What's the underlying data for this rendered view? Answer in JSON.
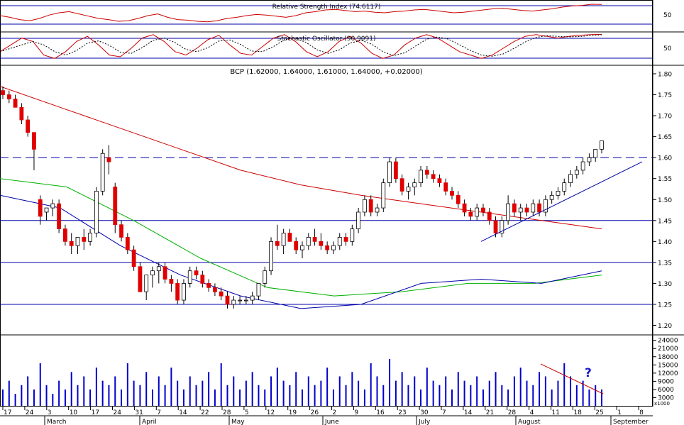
{
  "panels": {
    "rsi": {
      "title": "Relative Strength Index (74.6117)",
      "level_label": "50"
    },
    "stoch": {
      "title": "Stochastic Oscillator (90.9091)",
      "level_label": "50"
    },
    "price": {
      "title": "BCP (1.62000, 1.64000, 1.61000, 1.64000, +0.02000)"
    },
    "volume": {
      "annotation": "?"
    }
  },
  "colors": {
    "up_candle": "#ffffff",
    "down_candle": "#e00000",
    "moving_average_long": "#cc0000",
    "moving_average_short": "#00b000",
    "moving_average_mid": "#0000aa",
    "volume_bar": "#0000cc",
    "horizontal_level": "#0000aa",
    "trendline": "#0000aa",
    "volume_trendline": "#cc0000"
  },
  "chart_data": {
    "type": "candlestick",
    "title": "BCP (1.62000, 1.64000, 1.61000, 1.64000, +0.02000)",
    "price_axis": {
      "ylim": [
        1.17,
        1.82
      ],
      "ticks": [
        "1.80",
        "1.75",
        "1.70",
        "1.65",
        "1.60",
        "1.55",
        "1.50",
        "1.45",
        "1.40",
        "1.35",
        "1.30",
        "1.25",
        "1.20"
      ]
    },
    "horizontal_levels": [
      1.6,
      1.45,
      1.35,
      1.25
    ],
    "dashed_level": 1.6,
    "date_axis": {
      "day_ticks": [
        "17",
        "24",
        "3",
        "10",
        "17",
        "24",
        "31",
        "7",
        "14",
        "22",
        "28",
        "5",
        "12",
        "19",
        "26",
        "2",
        "9",
        "16",
        "23",
        "30",
        "7",
        "14",
        "21",
        "28",
        "4",
        "11",
        "18",
        "25",
        "1",
        "8"
      ],
      "month_labels": [
        "March",
        "April",
        "May",
        "June",
        "July",
        "August",
        "September"
      ]
    },
    "candles_ohlc": [
      [
        1.76,
        1.77,
        1.74,
        1.75
      ],
      [
        1.75,
        1.76,
        1.73,
        1.74
      ],
      [
        1.74,
        1.75,
        1.72,
        1.72
      ],
      [
        1.72,
        1.73,
        1.68,
        1.69
      ],
      [
        1.69,
        1.7,
        1.65,
        1.66
      ],
      [
        1.66,
        1.66,
        1.57,
        1.62
      ],
      [
        1.5,
        1.51,
        1.44,
        1.46
      ],
      [
        1.47,
        1.48,
        1.45,
        1.48
      ],
      [
        1.48,
        1.5,
        1.46,
        1.49
      ],
      [
        1.49,
        1.5,
        1.42,
        1.43
      ],
      [
        1.43,
        1.44,
        1.39,
        1.4
      ],
      [
        1.4,
        1.42,
        1.37,
        1.39
      ],
      [
        1.39,
        1.41,
        1.37,
        1.41
      ],
      [
        1.41,
        1.43,
        1.38,
        1.4
      ],
      [
        1.4,
        1.43,
        1.39,
        1.42
      ],
      [
        1.42,
        1.53,
        1.41,
        1.52
      ],
      [
        1.52,
        1.62,
        1.51,
        1.61
      ],
      [
        1.6,
        1.63,
        1.56,
        1.59
      ],
      [
        1.53,
        1.54,
        1.42,
        1.44
      ],
      [
        1.44,
        1.45,
        1.4,
        1.41
      ],
      [
        1.41,
        1.42,
        1.37,
        1.38
      ],
      [
        1.38,
        1.39,
        1.33,
        1.34
      ],
      [
        1.34,
        1.35,
        1.28,
        1.28
      ],
      [
        1.28,
        1.3,
        1.26,
        1.32
      ],
      [
        1.32,
        1.34,
        1.29,
        1.33
      ],
      [
        1.33,
        1.35,
        1.3,
        1.34
      ],
      [
        1.34,
        1.35,
        1.3,
        1.31
      ],
      [
        1.31,
        1.32,
        1.28,
        1.3
      ],
      [
        1.3,
        1.31,
        1.25,
        1.26
      ],
      [
        1.26,
        1.31,
        1.25,
        1.3
      ],
      [
        1.3,
        1.34,
        1.29,
        1.33
      ],
      [
        1.33,
        1.34,
        1.31,
        1.32
      ],
      [
        1.32,
        1.33,
        1.29,
        1.3
      ],
      [
        1.3,
        1.31,
        1.28,
        1.29
      ],
      [
        1.29,
        1.3,
        1.27,
        1.28
      ],
      [
        1.28,
        1.29,
        1.26,
        1.27
      ],
      [
        1.27,
        1.28,
        1.24,
        1.25
      ],
      [
        1.25,
        1.27,
        1.24,
        1.26
      ],
      [
        1.26,
        1.27,
        1.25,
        1.26
      ],
      [
        1.26,
        1.27,
        1.25,
        1.26
      ],
      [
        1.26,
        1.28,
        1.25,
        1.27
      ],
      [
        1.27,
        1.3,
        1.26,
        1.3
      ],
      [
        1.3,
        1.34,
        1.29,
        1.33
      ],
      [
        1.33,
        1.41,
        1.32,
        1.4
      ],
      [
        1.4,
        1.44,
        1.38,
        1.39
      ],
      [
        1.39,
        1.43,
        1.37,
        1.42
      ],
      [
        1.42,
        1.43,
        1.4,
        1.4
      ],
      [
        1.4,
        1.41,
        1.37,
        1.38
      ],
      [
        1.38,
        1.4,
        1.36,
        1.39
      ],
      [
        1.39,
        1.42,
        1.38,
        1.41
      ],
      [
        1.41,
        1.43,
        1.39,
        1.4
      ],
      [
        1.4,
        1.42,
        1.38,
        1.39
      ],
      [
        1.39,
        1.4,
        1.37,
        1.38
      ],
      [
        1.38,
        1.4,
        1.37,
        1.39
      ],
      [
        1.39,
        1.42,
        1.38,
        1.41
      ],
      [
        1.41,
        1.42,
        1.39,
        1.4
      ],
      [
        1.4,
        1.44,
        1.39,
        1.43
      ],
      [
        1.43,
        1.48,
        1.42,
        1.47
      ],
      [
        1.47,
        1.51,
        1.46,
        1.5
      ],
      [
        1.5,
        1.51,
        1.46,
        1.47
      ],
      [
        1.47,
        1.49,
        1.46,
        1.48
      ],
      [
        1.48,
        1.55,
        1.47,
        1.54
      ],
      [
        1.54,
        1.6,
        1.53,
        1.59
      ],
      [
        1.59,
        1.6,
        1.54,
        1.55
      ],
      [
        1.55,
        1.56,
        1.51,
        1.52
      ],
      [
        1.52,
        1.54,
        1.5,
        1.53
      ],
      [
        1.53,
        1.55,
        1.51,
        1.54
      ],
      [
        1.54,
        1.58,
        1.53,
        1.57
      ],
      [
        1.57,
        1.58,
        1.55,
        1.56
      ],
      [
        1.56,
        1.57,
        1.54,
        1.55
      ],
      [
        1.55,
        1.56,
        1.53,
        1.54
      ],
      [
        1.54,
        1.55,
        1.51,
        1.52
      ],
      [
        1.52,
        1.53,
        1.5,
        1.51
      ],
      [
        1.51,
        1.52,
        1.48,
        1.49
      ],
      [
        1.49,
        1.5,
        1.46,
        1.47
      ],
      [
        1.47,
        1.48,
        1.45,
        1.46
      ],
      [
        1.46,
        1.49,
        1.45,
        1.48
      ],
      [
        1.48,
        1.49,
        1.46,
        1.47
      ],
      [
        1.47,
        1.48,
        1.44,
        1.45
      ],
      [
        1.45,
        1.46,
        1.41,
        1.42
      ],
      [
        1.42,
        1.46,
        1.41,
        1.45
      ],
      [
        1.45,
        1.51,
        1.44,
        1.49
      ],
      [
        1.49,
        1.5,
        1.46,
        1.47
      ],
      [
        1.47,
        1.49,
        1.45,
        1.48
      ],
      [
        1.48,
        1.49,
        1.46,
        1.47
      ],
      [
        1.47,
        1.5,
        1.46,
        1.49
      ],
      [
        1.49,
        1.5,
        1.46,
        1.47
      ],
      [
        1.47,
        1.51,
        1.46,
        1.5
      ],
      [
        1.5,
        1.52,
        1.49,
        1.51
      ],
      [
        1.51,
        1.53,
        1.5,
        1.52
      ],
      [
        1.52,
        1.55,
        1.51,
        1.54
      ],
      [
        1.54,
        1.57,
        1.53,
        1.56
      ],
      [
        1.56,
        1.58,
        1.55,
        1.57
      ],
      [
        1.57,
        1.6,
        1.56,
        1.59
      ],
      [
        1.59,
        1.61,
        1.58,
        1.6
      ],
      [
        1.6,
        1.62,
        1.59,
        1.62
      ],
      [
        1.62,
        1.64,
        1.61,
        1.64
      ]
    ],
    "ma_long": [
      1.77,
      1.72,
      1.67,
      1.62,
      1.57,
      1.535,
      1.51,
      1.49,
      1.47,
      1.45,
      1.43
    ],
    "ma_short": [
      1.55,
      1.53,
      1.45,
      1.36,
      1.29,
      1.27,
      1.28,
      1.3,
      1.3,
      1.32
    ],
    "ma_mid": [
      1.51,
      1.48,
      1.39,
      1.32,
      1.27,
      1.24,
      1.25,
      1.3,
      1.31,
      1.3,
      1.33
    ],
    "trendline_start": 1.4,
    "trendline_end": 1.59,
    "volume_axis": {
      "ticks": [
        "24000",
        "21000",
        "18000",
        "15000",
        "12000",
        "9000",
        "6000",
        "3000"
      ],
      "scale_label": "x1000",
      "ylim": [
        0,
        26000
      ]
    },
    "rsi_values": [
      55,
      52,
      48,
      46,
      50,
      56,
      60,
      62,
      58,
      54,
      50,
      48,
      45,
      46,
      50,
      55,
      58,
      52,
      48,
      47,
      45,
      44,
      46,
      50,
      52,
      55,
      57,
      56,
      54,
      52,
      55,
      60,
      62,
      65,
      66,
      64,
      62,
      63,
      61,
      60,
      62,
      63,
      65,
      66,
      64,
      62,
      60,
      61,
      63,
      65,
      67,
      68,
      66,
      64,
      63,
      65,
      67,
      70,
      72,
      73,
      75,
      74.6
    ],
    "stoch_values": [
      40,
      60,
      80,
      70,
      30,
      20,
      40,
      70,
      85,
      60,
      30,
      25,
      50,
      80,
      90,
      70,
      40,
      30,
      50,
      75,
      88,
      60,
      35,
      30,
      55,
      80,
      90,
      70,
      40,
      25,
      40,
      70,
      85,
      65,
      35,
      20,
      30,
      60,
      80,
      90,
      80,
      60,
      40,
      30,
      20,
      30,
      50,
      70,
      85,
      90,
      85,
      80,
      85,
      88,
      90,
      90.9
    ]
  }
}
